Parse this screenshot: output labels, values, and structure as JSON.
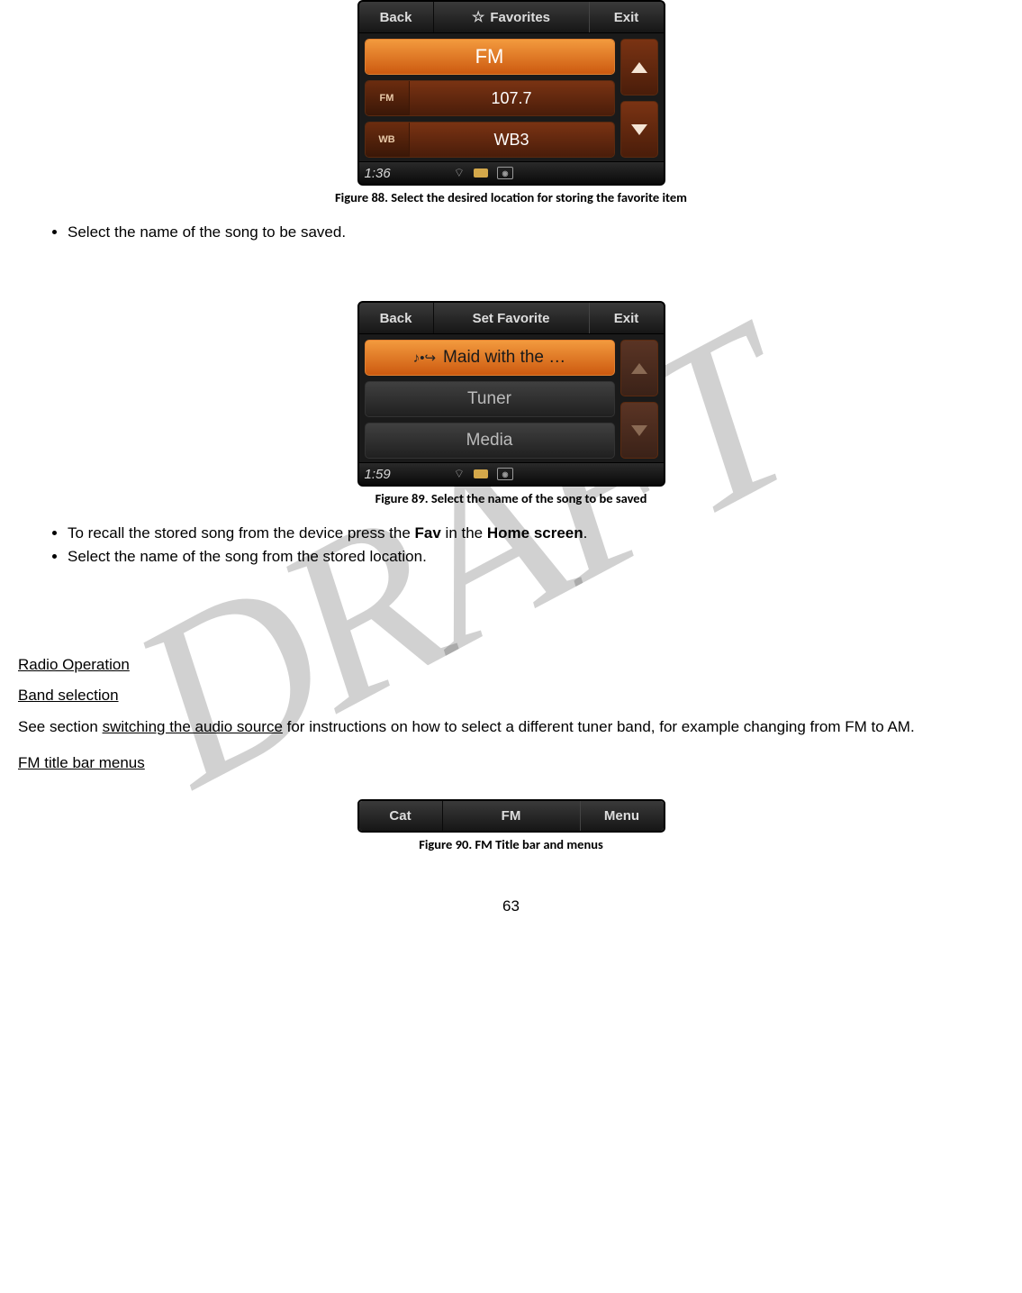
{
  "figure88": {
    "titlebar": {
      "back": "Back",
      "center": "Favorites",
      "exit": "Exit"
    },
    "rows": [
      {
        "badge": "",
        "main": "FM",
        "selected": true
      },
      {
        "badge": "FM",
        "main": "107.7"
      },
      {
        "badge": "WB",
        "main": "WB3"
      }
    ],
    "status_time": "1:36",
    "caption": "Figure 88. Select the desired location for storing the favorite item"
  },
  "bullets1": [
    "Select the name of the song to be saved."
  ],
  "figure89": {
    "titlebar": {
      "back": "Back",
      "center": "Set Favorite",
      "exit": "Exit"
    },
    "rows": [
      {
        "main": "Maid with the …",
        "selected": true,
        "hasIcon": true
      },
      {
        "main": "Tuner"
      },
      {
        "main": "Media"
      }
    ],
    "status_time": "1:59",
    "caption": "Figure 89. Select the name of the song to be saved"
  },
  "bullets2": [
    {
      "pre": "To recall the stored song from the device press the ",
      "b1": "Fav",
      "mid": " in the ",
      "b2": "Home screen",
      "post": "."
    },
    {
      "plain": "Select the name of the song from the stored location."
    }
  ],
  "section_radio": "Radio Operation",
  "section_band": "Band selection",
  "para_band_pre": "See section ",
  "para_band_link": "switching the audio source",
  "para_band_post": " for instructions on how to select a different tuner band, for example changing from FM to AM.",
  "section_fm_menus": "FM title bar menus",
  "figure90": {
    "left": "Cat",
    "center": "FM",
    "right": "Menu",
    "caption": "Figure 90. FM Title bar and menus"
  },
  "page_number": "63"
}
